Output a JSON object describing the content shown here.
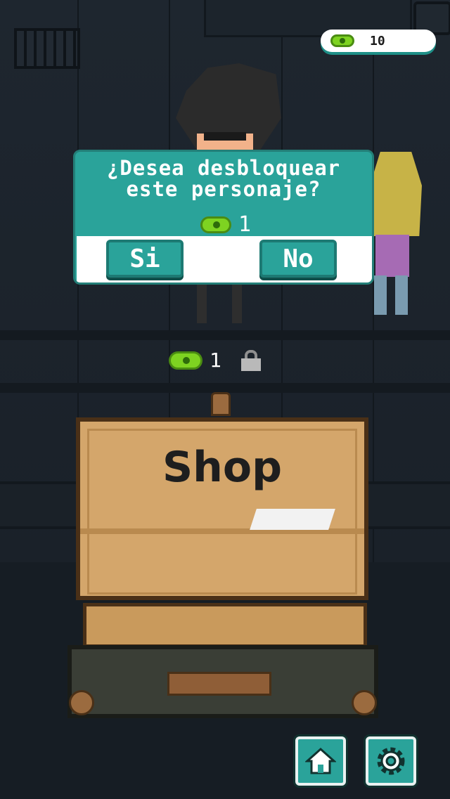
{
  "hud": {
    "coins": "10"
  },
  "character": {
    "price": "1"
  },
  "dialog": {
    "question_line1": "¿Desea desbloquear",
    "question_line2": "este personaje?",
    "price": "1",
    "yes_label": "Si",
    "no_label": "No"
  },
  "shop": {
    "title": "Shop"
  },
  "colors": {
    "teal": "#2aa39a",
    "coin": "#7ed321",
    "suitcase": "#d4a66b"
  },
  "icons": {
    "coin": "coin-icon",
    "lock": "lock-icon",
    "home": "home-icon",
    "settings": "gear-icon"
  }
}
